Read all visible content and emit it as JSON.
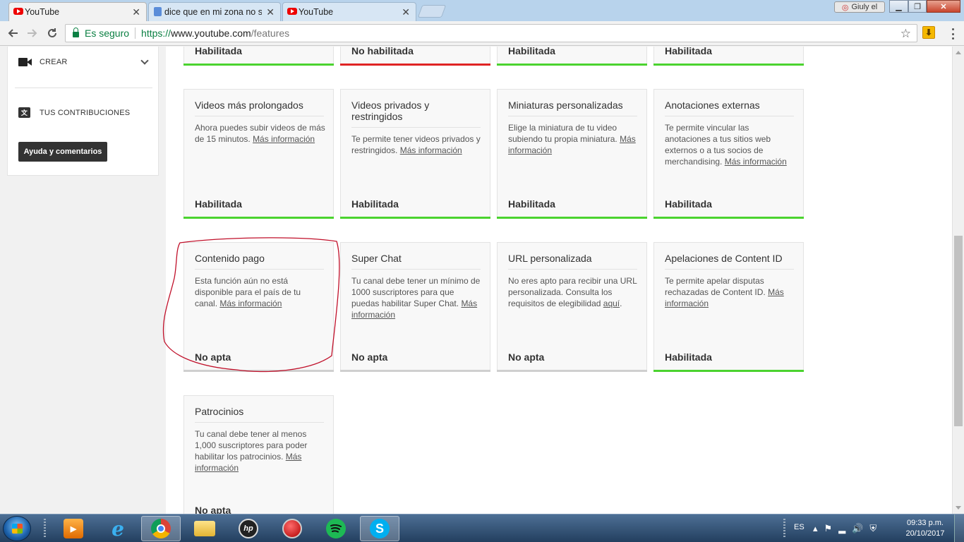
{
  "browser": {
    "tabs": [
      {
        "title": "YouTube",
        "icon": "youtube-icon",
        "active": true
      },
      {
        "title": "dice que en mi zona no s",
        "icon": "document-icon",
        "active": false
      },
      {
        "title": "YouTube",
        "icon": "youtube-icon",
        "active": false
      }
    ],
    "close_glyph": "✕",
    "profile_name": "Giuly el",
    "window_controls": {
      "minimize": "▁",
      "maximize": "❐",
      "close": "✕"
    },
    "secure_label": "Es seguro",
    "url": {
      "scheme": "https://",
      "host": "www.youtube.com",
      "path": "/features"
    }
  },
  "sidebar": {
    "create_label": "CREAR",
    "contributions_label": "TUS CONTRIBUCIONES",
    "help_button": "Ayuda y comentarios"
  },
  "features": {
    "top_row": [
      {
        "status": "Habilitada",
        "bar": "green"
      },
      {
        "status": "No habilitada",
        "bar": "red"
      },
      {
        "status": "Habilitada",
        "bar": "green"
      },
      {
        "status": "Habilitada",
        "bar": "green"
      }
    ],
    "row2": [
      {
        "title": "Videos más prolongados",
        "desc": "Ahora puedes subir videos de más de 15 minutos. ",
        "link": "Más información",
        "desc_after": "",
        "status": "Habilitada",
        "bar": "green"
      },
      {
        "title": "Videos privados y restringidos",
        "desc": "Te permite tener videos privados y restringidos. ",
        "link": "Más información",
        "desc_after": "",
        "status": "Habilitada",
        "bar": "green"
      },
      {
        "title": "Miniaturas personalizadas",
        "desc": "Elige la miniatura de tu video subiendo tu propia miniatura. ",
        "link": "Más información",
        "desc_after": "",
        "status": "Habilitada",
        "bar": "green"
      },
      {
        "title": "Anotaciones externas",
        "desc": "Te permite vincular las anotaciones a tus sitios web externos o a tus socios de merchandising. ",
        "link": "Más información",
        "desc_after": "",
        "status": "Habilitada",
        "bar": "green"
      }
    ],
    "row3": [
      {
        "title": "Contenido pago",
        "desc": "Esta función aún no está disponible para el país de tu canal. ",
        "link": "Más información",
        "desc_after": "",
        "status": "No apta",
        "bar": "gray"
      },
      {
        "title": "Super Chat",
        "desc": "Tu canal debe tener un mínimo de 1000 suscriptores para que puedas habilitar Super Chat. ",
        "link": "Más información",
        "desc_after": "",
        "status": "No apta",
        "bar": "gray"
      },
      {
        "title": "URL personalizada",
        "desc": "No eres apto para recibir una URL personalizada. Consulta los requisitos de elegibilidad ",
        "link": "aquí",
        "desc_after": ".",
        "status": "No apta",
        "bar": "gray"
      },
      {
        "title": "Apelaciones de Content ID",
        "desc": "Te permite apelar disputas rechazadas de Content ID. ",
        "link": "Más información",
        "desc_after": "",
        "status": "Habilitada",
        "bar": "green"
      }
    ],
    "row4": [
      {
        "title": "Patrocinios",
        "desc": "Tu canal debe tener al menos 1,000 suscriptores para poder habilitar los patrocinios. ",
        "link": "Más información",
        "desc_after": "",
        "status": "No apta",
        "bar": "gray"
      }
    ]
  },
  "taskbar": {
    "apps": [
      "media-player-icon",
      "internet-explorer-icon",
      "chrome-icon",
      "file-explorer-icon",
      "hp-icon",
      "recorder-icon",
      "spotify-icon",
      "skype-icon"
    ],
    "hp_label": "hp",
    "language": "ES",
    "time": "09:33 p.m.",
    "date": "20/10/2017"
  },
  "colors": {
    "enabled": "#4bd32f",
    "disabled": "#e02424",
    "ineligible": "#cfcfcf",
    "annotation": "#c0102a"
  }
}
